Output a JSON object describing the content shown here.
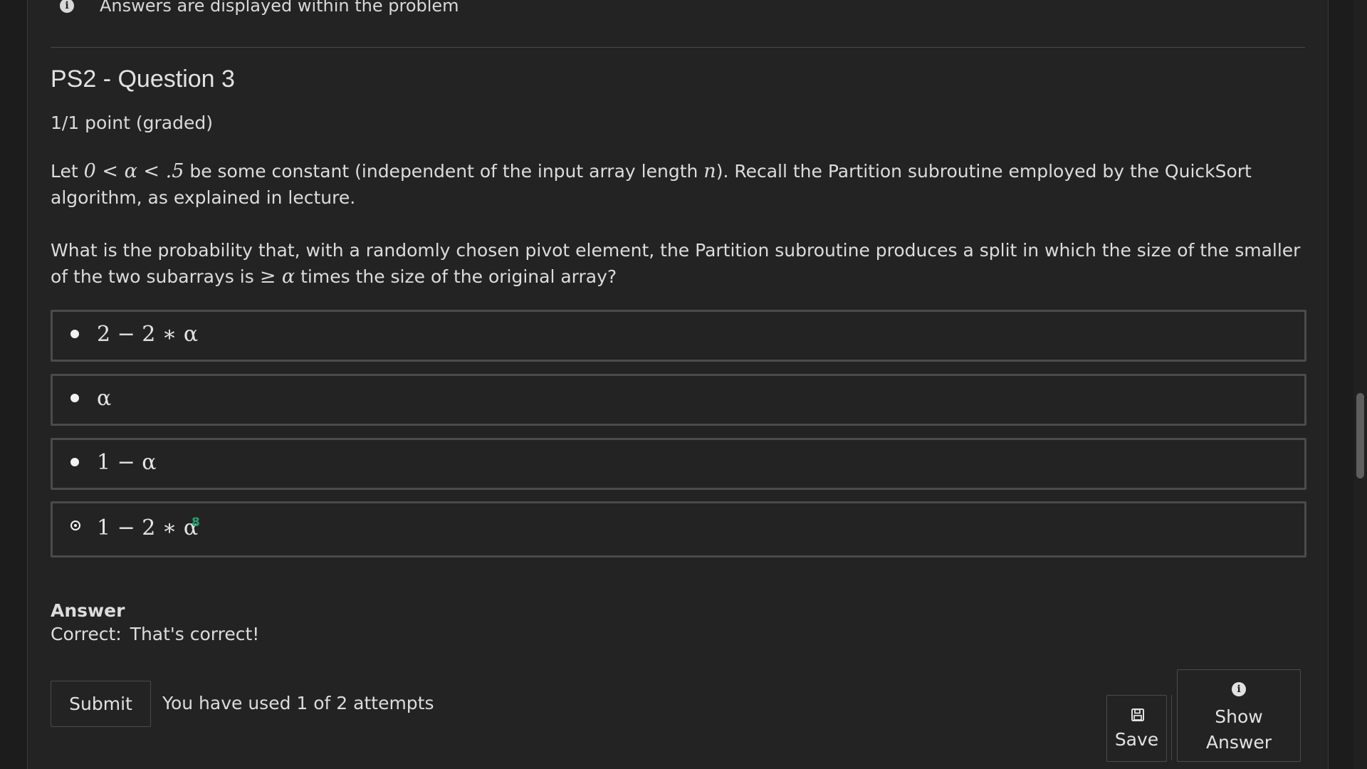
{
  "notice": {
    "text": "Answers are displayed within the problem",
    "icon": "info-icon"
  },
  "problem": {
    "title": "PS2 - Question 3",
    "points": "1/1 point (graded)",
    "para1": {
      "t1": "Let ",
      "m1": "0 < α < .5",
      "t2": " be some constant (independent of the input array length ",
      "m2": "n",
      "t3": "). Recall the Partition subroutine employed by the QuickSort algorithm, as explained in lecture."
    },
    "para2": {
      "t1": "What is the probability that, with a randomly chosen pivot element, the Partition subroutine produces a split in which the size of the smaller of the two subarrays is ",
      "m1": "≥ α",
      "t2": " times the size of the original array?"
    },
    "choices": [
      {
        "label": "2 − 2 ∗ α",
        "selected": false
      },
      {
        "label": "α",
        "selected": false
      },
      {
        "label": "1 − α",
        "selected": false
      },
      {
        "label": "1 − 2 ∗ α",
        "selected": true,
        "marker": "8"
      }
    ]
  },
  "answer": {
    "heading": "Answer",
    "status": "Correct:",
    "message": "That's correct!"
  },
  "actions": {
    "submit_label": "Submit",
    "attempts_text": "You have used 1 of 2 attempts",
    "save_label": "Save",
    "save_icon": "save-icon",
    "show_answer_line1": "Show",
    "show_answer_line2": "Answer",
    "show_answer_icon": "info-icon"
  },
  "colors": {
    "background": "#222222",
    "text": "#dddddd",
    "border": "#4b4b4b",
    "marker": "#1fa36c"
  }
}
